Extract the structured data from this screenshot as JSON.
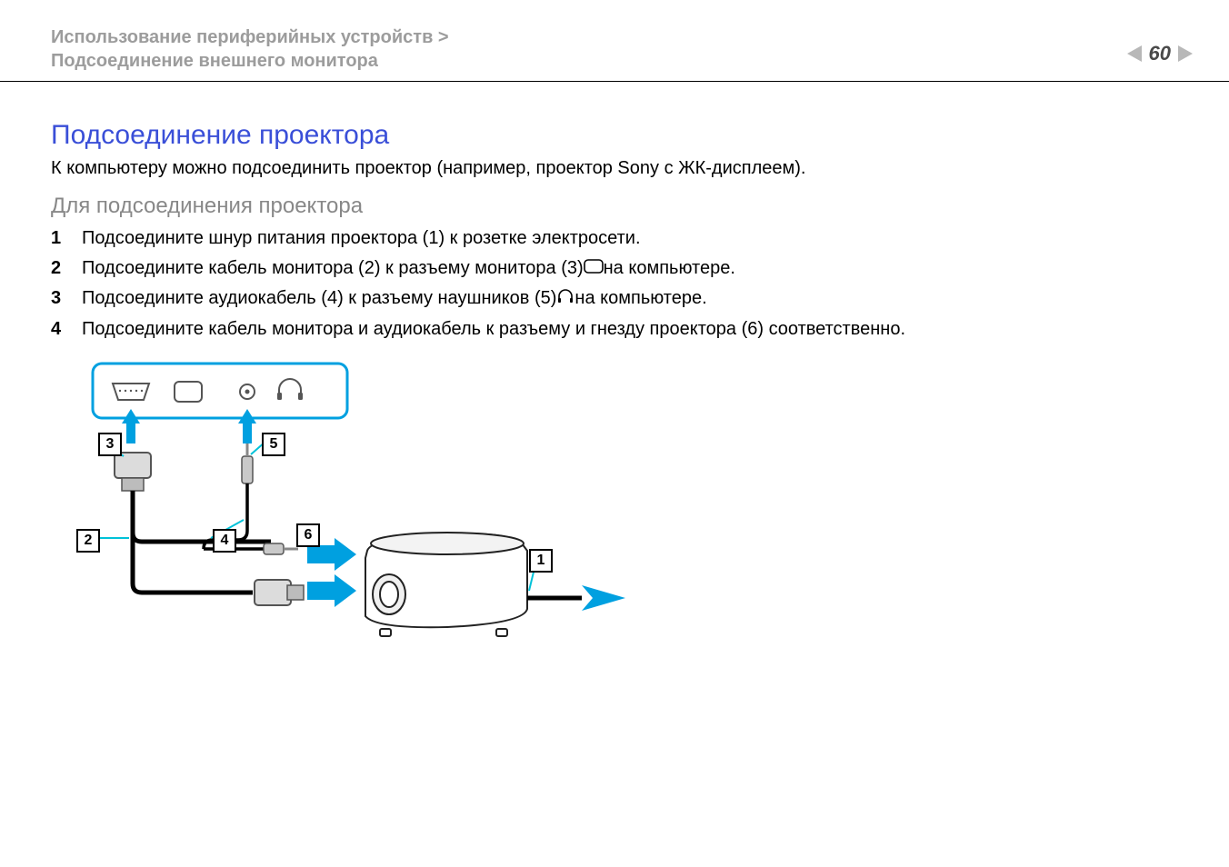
{
  "header": {
    "breadcrumb_line1": "Использование периферийных устройств >",
    "breadcrumb_line2": "Подсоединение внешнего монитора",
    "page_number": "60"
  },
  "content": {
    "title": "Подсоединение проектора",
    "intro": "К компьютеру можно подсоединить проектор (например, проектор Sony с ЖК-дисплеем).",
    "subtitle": "Для подсоединения проектора",
    "steps": [
      {
        "prefix": "Подсоедините шнур питания проектора (1) к розетке электросети.",
        "inline_icon": null,
        "suffix": ""
      },
      {
        "prefix": "Подсоедините кабель монитора (2) к разъему монитора (3) ",
        "inline_icon": "monitor-port-icon",
        "suffix": " на компьютере."
      },
      {
        "prefix": "Подсоедините аудиокабель (4) к разъему наушников (5) ",
        "inline_icon": "headphones-icon",
        "suffix": " на компьютере."
      },
      {
        "prefix": "Подсоедините кабель монитора и аудиокабель к разъему и гнезду проектора (6) соответственно.",
        "inline_icon": null,
        "suffix": ""
      }
    ]
  },
  "diagram": {
    "callouts": {
      "c1": "1",
      "c2": "2",
      "c3": "3",
      "c4": "4",
      "c5": "5",
      "c6": "6"
    }
  }
}
